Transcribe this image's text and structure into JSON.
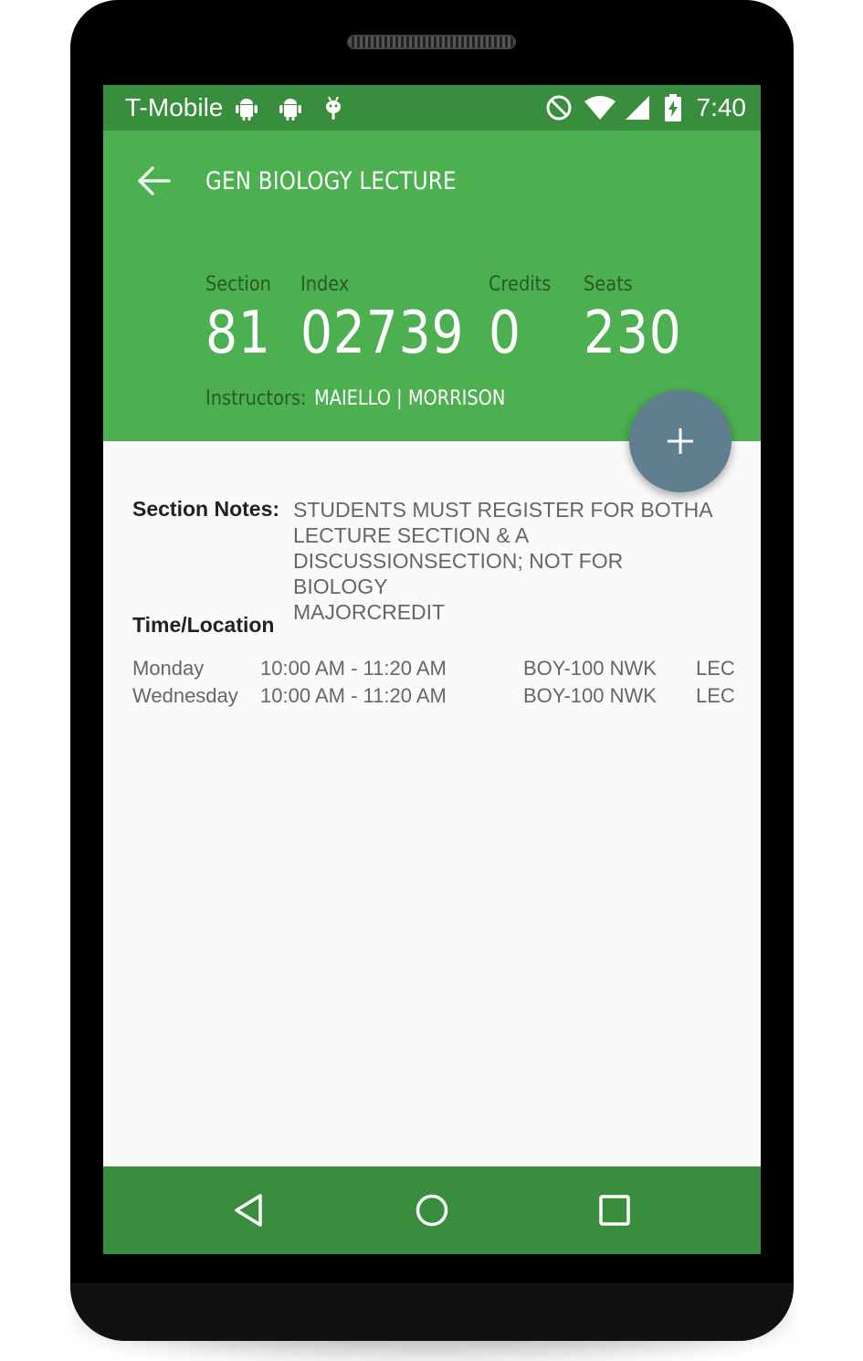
{
  "status_bar": {
    "carrier": "T-Mobile",
    "time": "7:40",
    "icons": [
      "android-icon",
      "android-icon",
      "bug-icon",
      "do-not-disturb-icon",
      "wifi-icon",
      "signal-icon",
      "battery-charging-icon"
    ]
  },
  "app_bar": {
    "title": "GEN BIOLOGY LECTURE",
    "stats": {
      "section_label": "Section",
      "section_value": "81",
      "index_label": "Index",
      "index_value": "02739",
      "credits_label": "Credits",
      "credits_value": "0",
      "seats_label": "Seats",
      "seats_value": "230"
    },
    "instructors_label": "Instructors:",
    "instructors_value": "MAIELLO | MORRISON"
  },
  "fab": {
    "icon": "plus-icon"
  },
  "content": {
    "notes_label": "Section Notes:",
    "notes_lines": [
      "STUDENTS MUST REGISTER FOR BOTHA",
      "LECTURE SECTION & A",
      "DISCUSSIONSECTION; NOT FOR BIOLOGY",
      "MAJORCREDIT"
    ],
    "time_location_heading": "Time/Location",
    "meetings": [
      {
        "day": "Monday",
        "time": "10:00 AM - 11:20 AM",
        "location": "BOY-100 NWK",
        "type": "LEC"
      },
      {
        "day": "Wednesday",
        "time": "10:00 AM - 11:20 AM",
        "location": "BOY-100 NWK",
        "type": "LEC"
      }
    ]
  },
  "nav_bar": {
    "buttons": [
      "back-triangle-icon",
      "home-circle-icon",
      "recents-square-icon"
    ]
  },
  "colors": {
    "status_bar": "#388e3c",
    "app_bar": "#4caf50",
    "fab": "#5f7f8e",
    "background": "#fafafa"
  }
}
